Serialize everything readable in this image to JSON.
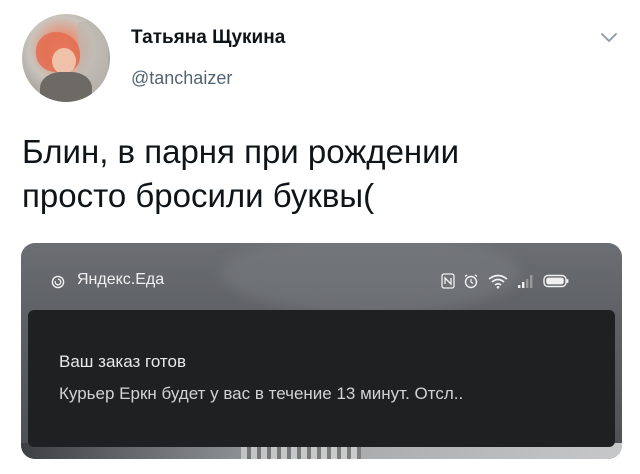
{
  "tweet": {
    "author": {
      "display_name": "Татьяна Щукина",
      "handle": "@tanchaizer"
    },
    "text_lines": [
      "Блин, в парня при рождении",
      "просто бросили буквы("
    ],
    "menu_icon": "chevron-down-icon"
  },
  "screenshot": {
    "status_bar": {
      "app_icon": "yandex-eda-icon",
      "app_label": "Яндекс.Еда",
      "icons": [
        "nfc-icon",
        "alarm-icon",
        "wifi-icon",
        "signal-icon",
        "battery-icon"
      ]
    },
    "notification": {
      "title": "Ваш заказ готов",
      "body": "Курьер Еркн будет у вас в течение 13 минут. Отсл.."
    }
  },
  "colors": {
    "text_primary": "#0f1419",
    "text_secondary": "#536471",
    "notification_bg": "#1f2022",
    "notification_text": "#e9e9e9"
  }
}
